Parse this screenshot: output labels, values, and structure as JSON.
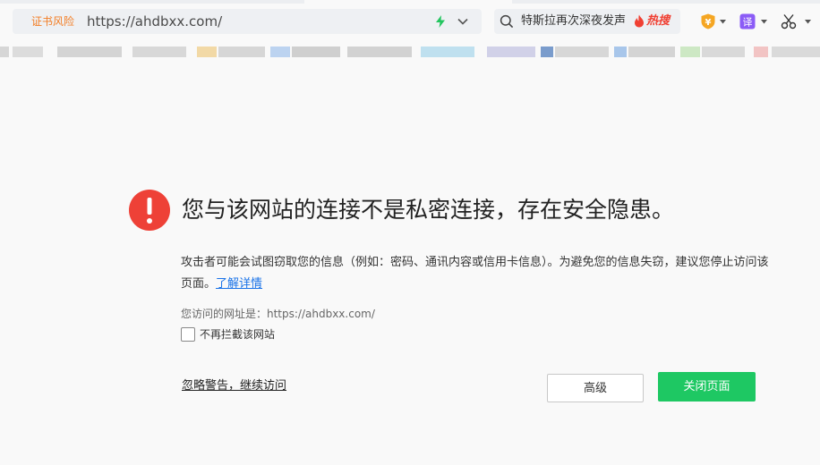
{
  "addressbar": {
    "cert_warning": "证书风险",
    "url": "https://ahdbxx.com/"
  },
  "searchbox": {
    "query": "特斯拉再次深夜发声",
    "hot_label": "热搜"
  },
  "extensions": {
    "shield_glyph": "¥",
    "translate_glyph": "译"
  },
  "warning": {
    "title": "您与该网站的连接不是私密连接，存在安全隐患。",
    "description": "攻击者可能会试图窃取您的信息（例如：密码、通讯内容或信用卡信息）。为避免您的信息失窃，建议您停止访问该页面。",
    "learn_more": "了解详情",
    "visited_url": "您访问的网址是：https://ahdbxx.com/",
    "dont_block_label": "不再拦截该网站",
    "ignore_link": "忽略警告，继续访问",
    "advanced_button": "高级",
    "close_button": "关闭页面"
  },
  "colors": {
    "cert_warning": "#f37d24",
    "alert_red": "#ee4137",
    "link_blue": "#1a73e8",
    "close_green": "#1ec863",
    "hot_red": "#f04033"
  }
}
